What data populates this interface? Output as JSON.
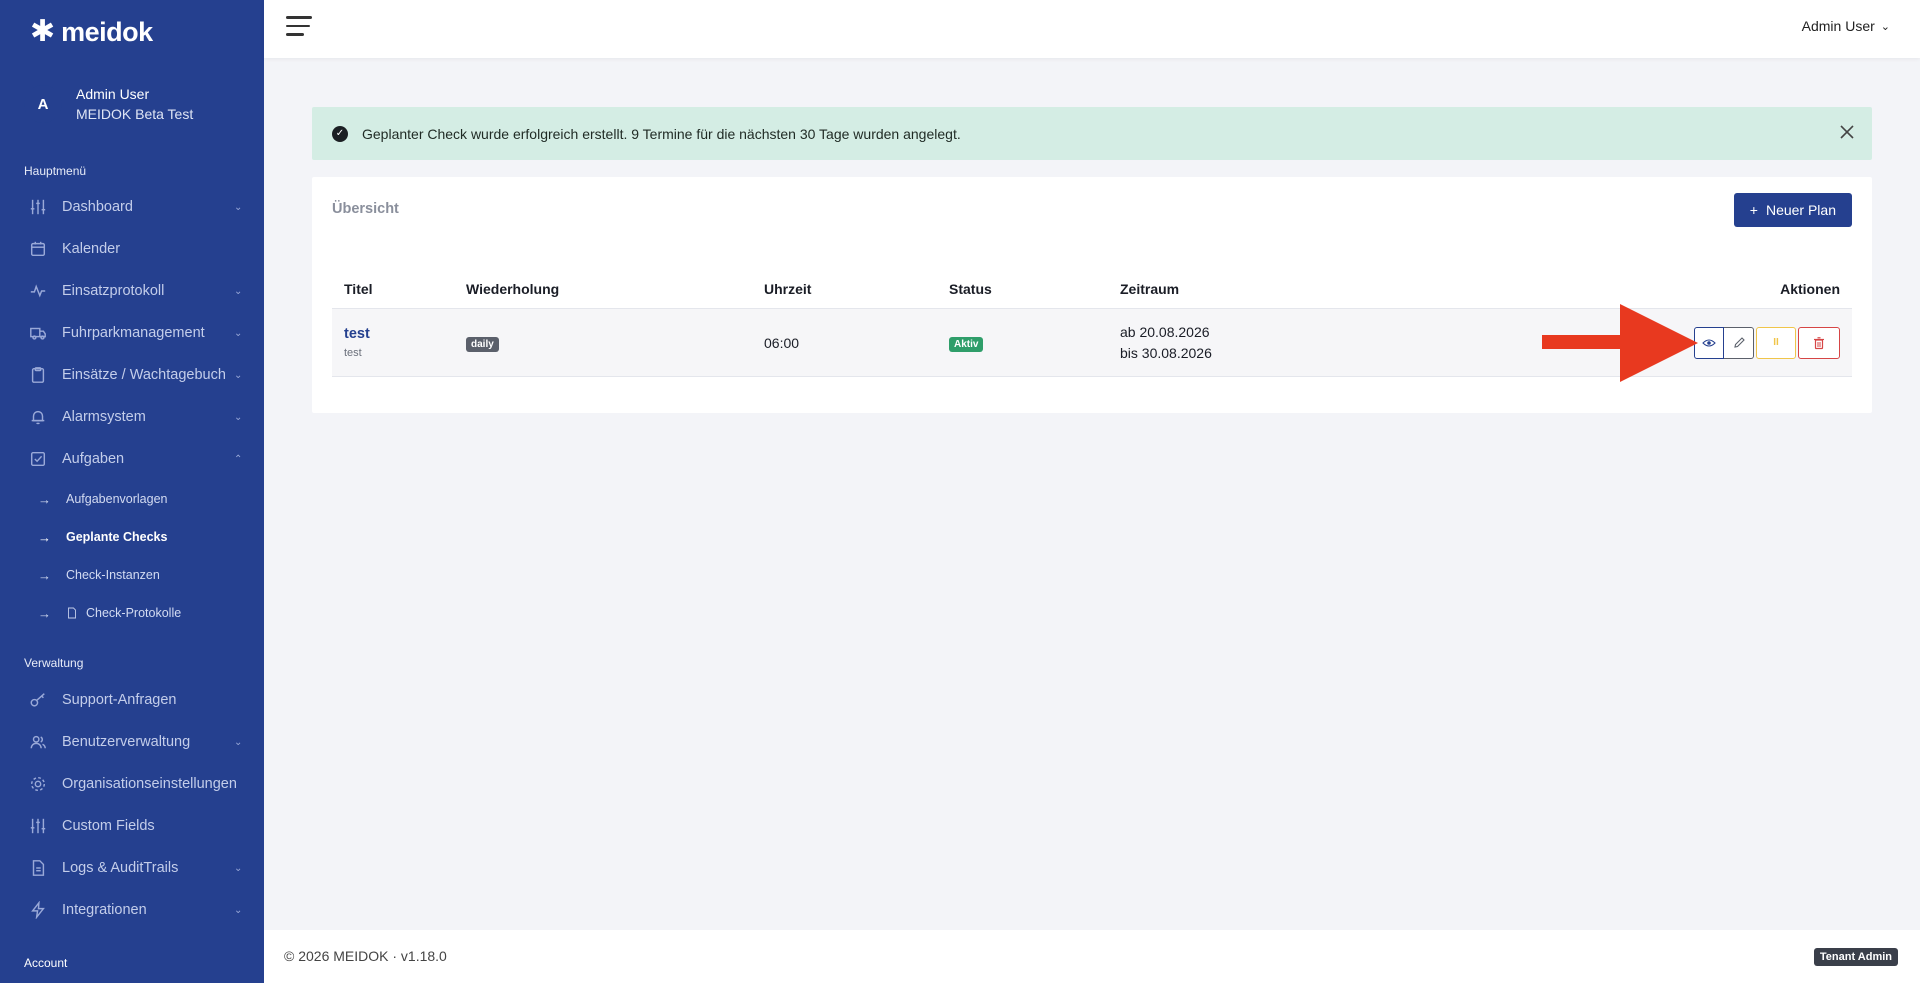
{
  "app": {
    "logo_text": "meidok"
  },
  "user": {
    "avatar_letter": "A",
    "name": "Admin User",
    "org": "MEIDOK Beta Test"
  },
  "sidebar": {
    "main_section": "Hauptmenü",
    "main_items": [
      {
        "label": "Dashboard",
        "icon": "sliders-icon",
        "chevron": "down"
      },
      {
        "label": "Kalender",
        "icon": "calendar-icon",
        "chevron": ""
      },
      {
        "label": "Einsatzprotokoll",
        "icon": "activity-icon",
        "chevron": "down"
      },
      {
        "label": "Fuhrparkmanagement",
        "icon": "truck-icon",
        "chevron": "down"
      },
      {
        "label": "Einsätze / Wachtagebuch",
        "icon": "clipboard-icon",
        "chevron": "down"
      },
      {
        "label": "Alarmsystem",
        "icon": "bell-icon",
        "chevron": "down"
      },
      {
        "label": "Aufgaben",
        "icon": "checkbox-icon",
        "chevron": "up"
      }
    ],
    "sub_items": [
      {
        "label": "Aufgabenvorlagen",
        "active": false
      },
      {
        "label": "Geplante Checks",
        "active": true
      },
      {
        "label": "Check-Instanzen",
        "active": false
      },
      {
        "label": "Check-Protokolle",
        "active": false
      }
    ],
    "admin_section": "Verwaltung",
    "admin_items": [
      {
        "label": "Support-Anfragen",
        "icon": "key-icon",
        "chevron": ""
      },
      {
        "label": "Benutzerverwaltung",
        "icon": "users-icon",
        "chevron": "down"
      },
      {
        "label": "Organisationseinstellungen",
        "icon": "gear-icon",
        "chevron": ""
      },
      {
        "label": "Custom Fields",
        "icon": "sliders-icon",
        "chevron": ""
      },
      {
        "label": "Logs & AuditTrails",
        "icon": "document-icon",
        "chevron": "down"
      },
      {
        "label": "Integrationen",
        "icon": "bolt-icon",
        "chevron": "down"
      }
    ],
    "bottom_label": "Account"
  },
  "topbar": {
    "user_menu": "Admin User"
  },
  "alert": {
    "text": "Geplanter Check wurde erfolgreich erstellt. 9 Termine für die nächsten 30 Tage wurden angelegt."
  },
  "card": {
    "title": "Übersicht",
    "new_button": "Neuer Plan",
    "headers": {
      "title": "Titel",
      "repeat": "Wiederholung",
      "time": "Uhrzeit",
      "status": "Status",
      "range": "Zeitraum",
      "actions": "Aktionen"
    },
    "rows": [
      {
        "title": "test",
        "subtitle": "test",
        "repeat": "daily",
        "time": "06:00",
        "status": "Aktiv",
        "range_from": "ab 20.08.2026",
        "range_to": "bis 30.08.2026"
      }
    ]
  },
  "footer": {
    "text": "© 2026 MEIDOK · v1.18.0",
    "badge": "Tenant Admin"
  },
  "colors": {
    "sidebar": "#25408f",
    "accent": "#25408f",
    "success_bg": "#d4ede4",
    "active_badge": "#2f9e6a",
    "danger": "#d64545",
    "warning": "#f0c54a",
    "annotation": "#e8391f"
  }
}
